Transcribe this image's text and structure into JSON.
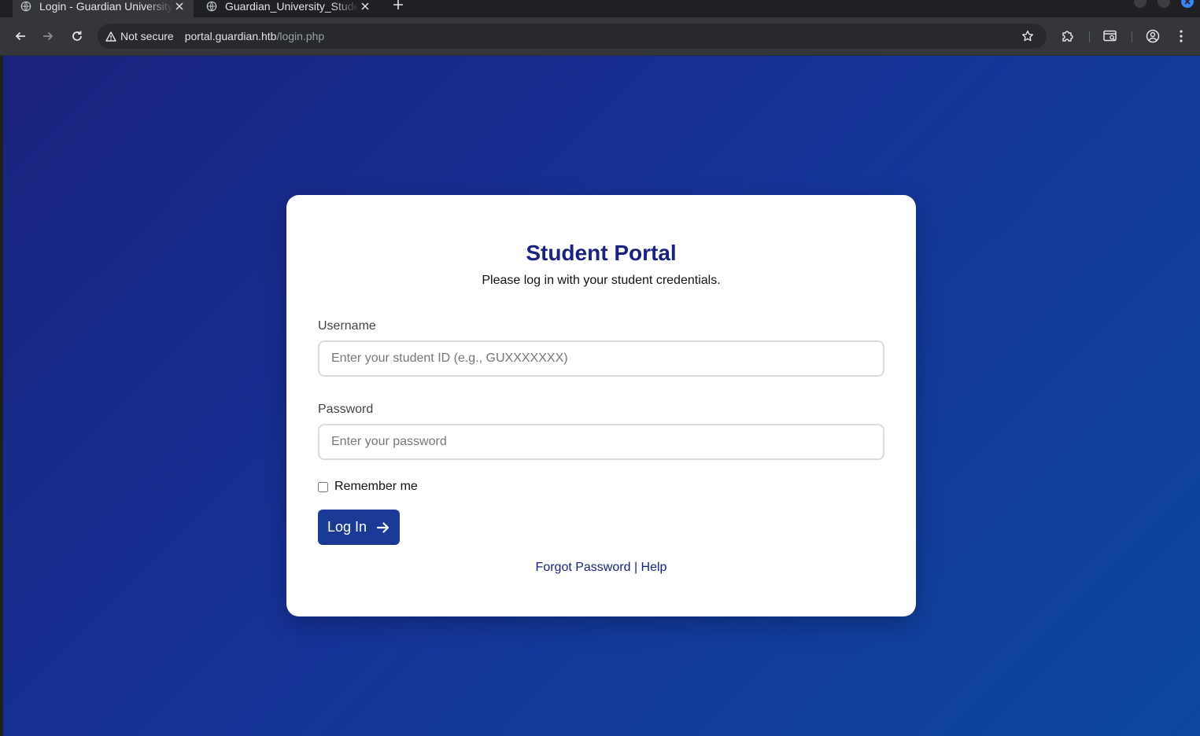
{
  "browser": {
    "tabs": [
      {
        "title": "Login - Guardian University",
        "active": true
      },
      {
        "title": "Guardian_University_Student",
        "active": false
      }
    ],
    "security_label": "Not secure",
    "url_host": "portal.guardian.htb",
    "url_path": "/login.php"
  },
  "login": {
    "title": "Student Portal",
    "subtitle": "Please log in with your student credentials.",
    "username_label": "Username",
    "username_placeholder": "Enter your student ID (e.g., GUXXXXXXX)",
    "password_label": "Password",
    "password_placeholder": "Enter your password",
    "remember_label": "Remember me",
    "login_button": "Log In",
    "forgot_link": "Forgot Password",
    "separator": "|",
    "help_link": "Help"
  },
  "colors": {
    "brand_navy": "#1a237e",
    "button_blue": "#1a3a96",
    "gradient_start": "#1a237e",
    "gradient_end": "#0d47a1"
  }
}
